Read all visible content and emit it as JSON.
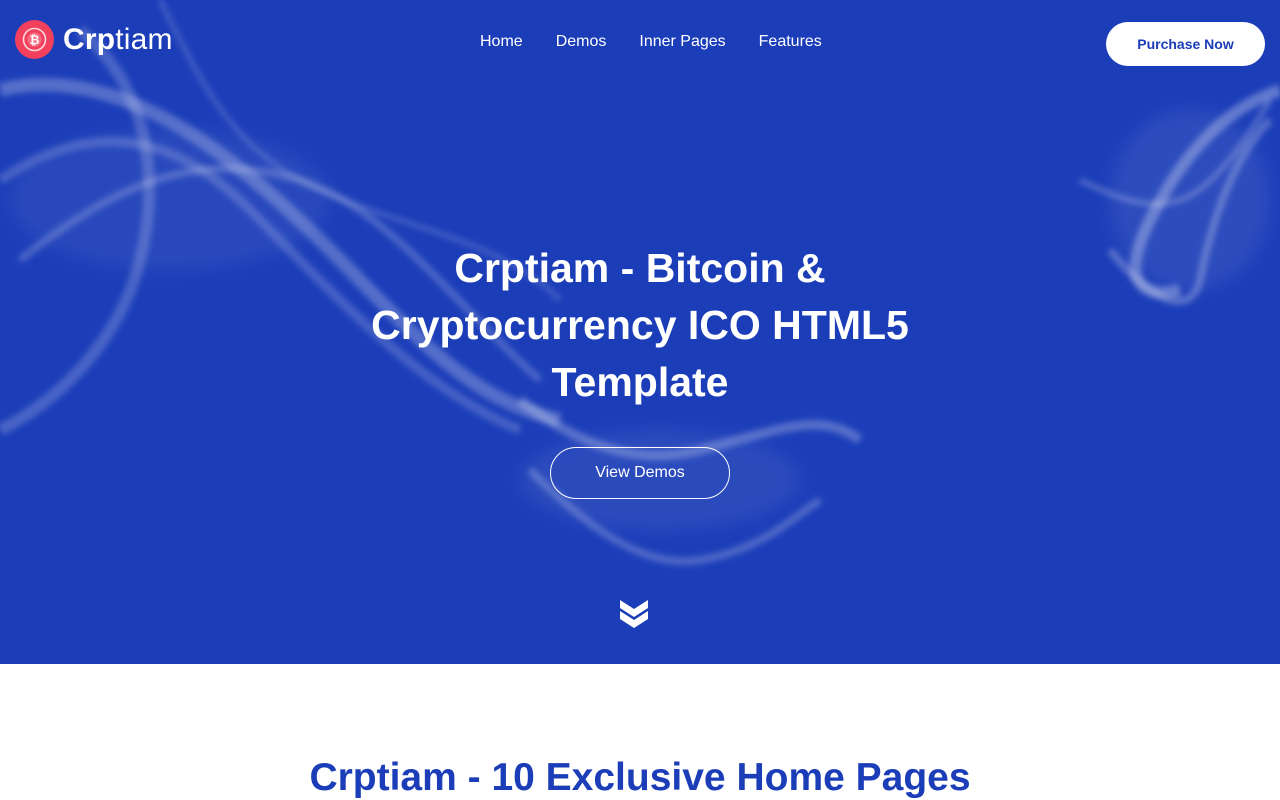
{
  "brand": {
    "name_bold": "Crp",
    "name_light": "tiam",
    "logo_icon": "bitcoin-coin-icon",
    "logo_color": "#f2405d"
  },
  "nav": {
    "items": [
      "Home",
      "Demos",
      "Inner Pages",
      "Features"
    ]
  },
  "header": {
    "cta_label": "Purchase Now"
  },
  "hero": {
    "title": "Crptiam - Bitcoin & Cryptocurrency ICO HTML5 Template",
    "button_label": "View Demos",
    "scroll_icon": "double-chevron-down-icon",
    "background_color": "#1b3db8"
  },
  "section": {
    "title": "Crptiam - 10 Exclusive Home Pages"
  }
}
